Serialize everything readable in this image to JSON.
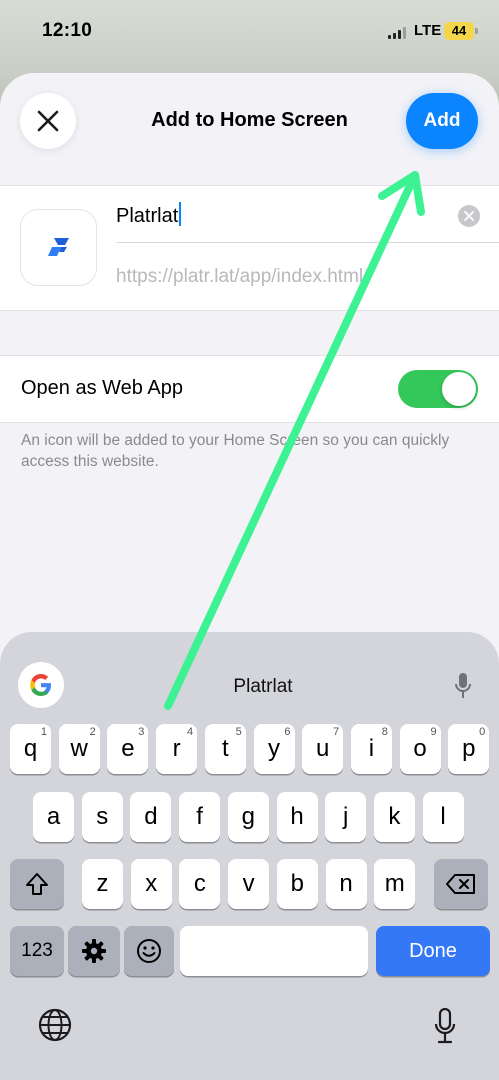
{
  "status_bar": {
    "time": "12:10",
    "network": "LTE",
    "battery": "44",
    "battery_color": "#f3d64a"
  },
  "sheet": {
    "title": "Add to Home Screen",
    "close_icon": "close-icon",
    "add_label": "Add",
    "accent_color": "#0a84ff"
  },
  "app": {
    "icon": "platrlat-logo-icon",
    "name_value": "Platrlat",
    "url": "https://platr.lat/app/index.html"
  },
  "web_app": {
    "label": "Open as Web App",
    "enabled": true,
    "toggle_color": "#34c759",
    "helper": "An icon will be added to your Home Screen so you can quickly access this website."
  },
  "keyboard": {
    "suggestion": "Platrlat",
    "row1": [
      {
        "label": "q",
        "hint": "1"
      },
      {
        "label": "w",
        "hint": "2"
      },
      {
        "label": "e",
        "hint": "3"
      },
      {
        "label": "r",
        "hint": "4"
      },
      {
        "label": "t",
        "hint": "5"
      },
      {
        "label": "y",
        "hint": "6"
      },
      {
        "label": "u",
        "hint": "7"
      },
      {
        "label": "i",
        "hint": "8"
      },
      {
        "label": "o",
        "hint": "9"
      },
      {
        "label": "p",
        "hint": "0"
      }
    ],
    "row2": [
      "a",
      "s",
      "d",
      "f",
      "g",
      "h",
      "j",
      "k",
      "l"
    ],
    "row3": [
      "z",
      "x",
      "c",
      "v",
      "b",
      "n",
      "m"
    ],
    "numbers_label": "123",
    "done_label": "Done",
    "done_color": "#3478f6"
  },
  "annotation": {
    "arrow_color": "#3cf293"
  }
}
